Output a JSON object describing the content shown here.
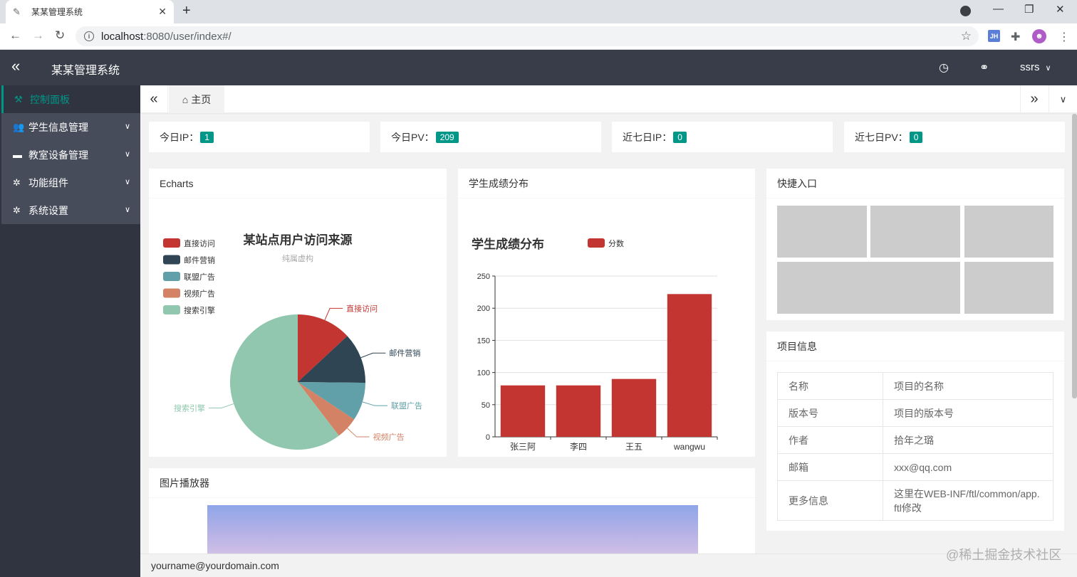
{
  "browser": {
    "tab_title": "某某管理系统",
    "tab_close": "✕",
    "new_tab": "+",
    "url_host": "localhost",
    "url_path": ":8080/user/index#/",
    "ext_jh": "JH"
  },
  "header": {
    "title": "某某管理系统",
    "user": "ssrs"
  },
  "sidebar": {
    "items": [
      {
        "label": "控制面板",
        "icon": "dashboard-icon"
      },
      {
        "label": "学生信息管理",
        "icon": "users-icon"
      },
      {
        "label": "教室设备管理",
        "icon": "monitor-icon"
      },
      {
        "label": "功能组件",
        "icon": "gear-icon"
      },
      {
        "label": "系统设置",
        "icon": "gear-icon"
      }
    ]
  },
  "tabstrip": {
    "home_label": "主页"
  },
  "stats": [
    {
      "label": "今日IP：",
      "value": "1"
    },
    {
      "label": "今日PV：",
      "value": "209"
    },
    {
      "label": "近七日IP：",
      "value": "0"
    },
    {
      "label": "近七日PV：",
      "value": "0"
    }
  ],
  "cards": {
    "echarts": "Echarts",
    "scores": "学生成绩分布",
    "quick": "快捷入口",
    "project": "项目信息",
    "player": "图片播放器"
  },
  "project_info": [
    {
      "key": "名称",
      "value": "项目的名称"
    },
    {
      "key": "版本号",
      "value": "项目的版本号"
    },
    {
      "key": "作者",
      "value": "拾年之璐"
    },
    {
      "key": "邮箱",
      "value": "xxx@qq.com"
    },
    {
      "key": "更多信息",
      "value": "这里在WEB-INF/ftl/common/app.ftl修改"
    }
  ],
  "footer": "yourname@yourdomain.com",
  "watermark": "@稀土掘金技术社区",
  "colors": {
    "header_bg": "#393d49",
    "sidebar_bg": "#2f3440",
    "accent": "#009688",
    "bar": "#c23531"
  },
  "chart_data": [
    {
      "type": "pie",
      "title": "某站点用户访问来源",
      "subtitle": "纯属虚构",
      "legend_position": "top-left",
      "slices": [
        {
          "name": "直接访问",
          "value": 335,
          "color": "#c23531"
        },
        {
          "name": "邮件营销",
          "value": 310,
          "color": "#2f4554"
        },
        {
          "name": "联盟广告",
          "value": 234,
          "color": "#61a0a8"
        },
        {
          "name": "视频广告",
          "value": 135,
          "color": "#d48265"
        },
        {
          "name": "搜索引擎",
          "value": 1548,
          "color": "#91c7ae"
        }
      ]
    },
    {
      "type": "bar",
      "title": "学生成绩分布",
      "categories": [
        "张三阿",
        "李四",
        "王五",
        "wangwu"
      ],
      "series": [
        {
          "name": "分数",
          "values": [
            80,
            80,
            90,
            222
          ],
          "color": "#c23531"
        }
      ],
      "ylim": [
        0,
        250
      ],
      "yticks": [
        0,
        50,
        100,
        150,
        200,
        250
      ],
      "grid": true,
      "legend_position": "top"
    }
  ]
}
